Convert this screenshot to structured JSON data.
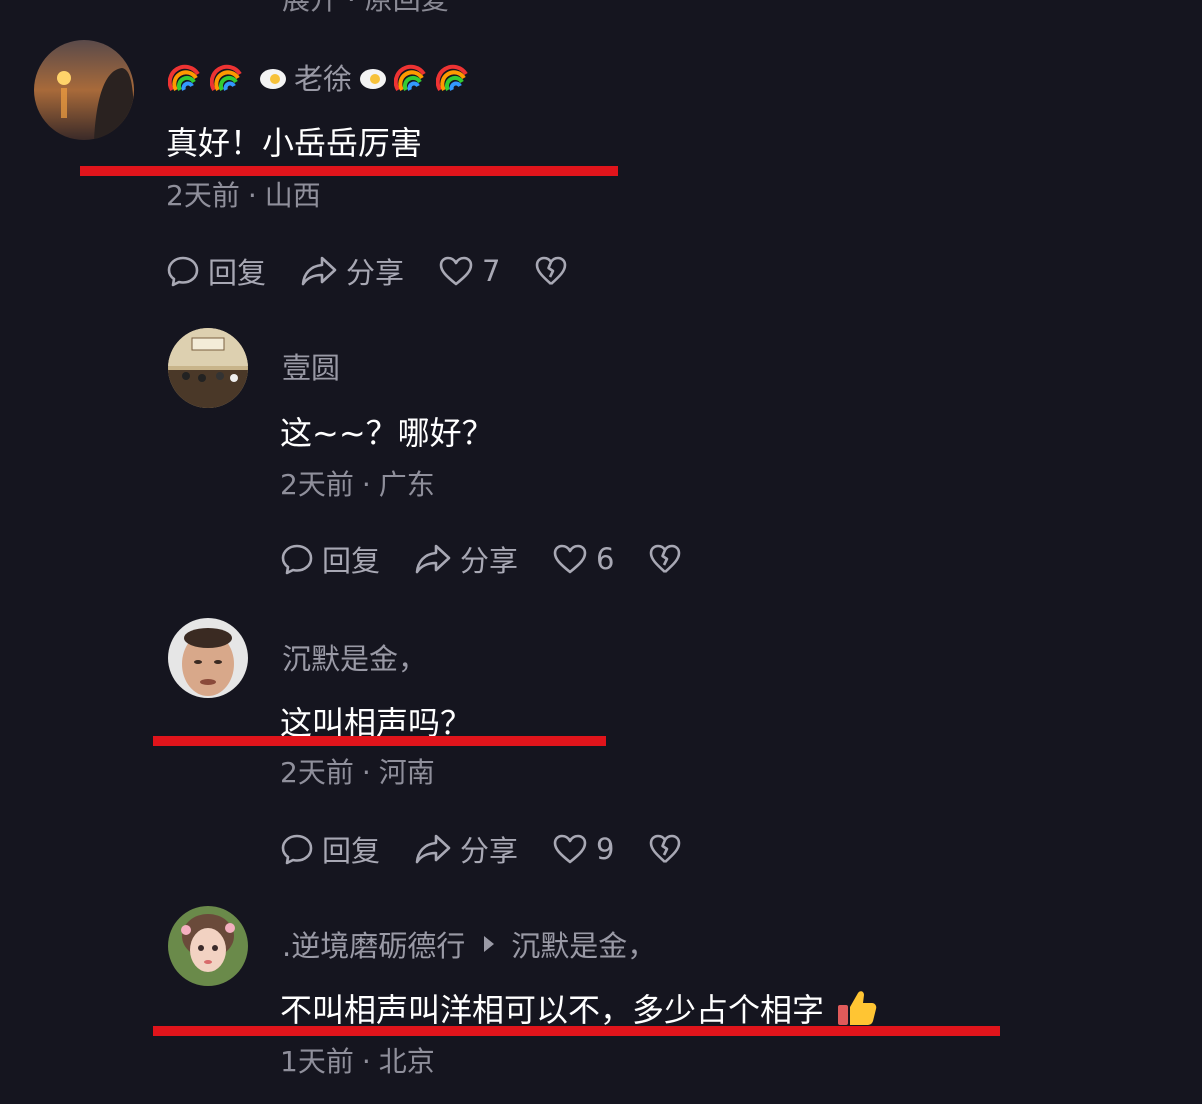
{
  "top_cut_text": "展开 · 原回复",
  "comments": [
    {
      "username": "老徐",
      "content": "真好！小岳岳厉害",
      "time": "2天前",
      "location": "山西",
      "reply_label": "回复",
      "share_label": "分享",
      "likes": "7"
    },
    {
      "username": "壹圆",
      "content": "这~~？哪好？",
      "time": "2天前",
      "location": "广东",
      "reply_label": "回复",
      "share_label": "分享",
      "likes": "6"
    },
    {
      "username": "沉默是金，",
      "content": "这叫相声吗？",
      "time": "2天前",
      "location": "河南",
      "reply_label": "回复",
      "share_label": "分享",
      "likes": "9"
    },
    {
      "username": ".逆境磨砺德行",
      "reply_to": "沉默是金，",
      "content": "不叫相声叫洋相可以不，多少占个相字",
      "time": "1天前",
      "location": "北京"
    }
  ],
  "separator": "·",
  "colors": {
    "background": "#15151f",
    "underline": "#e0141b",
    "text_primary": "#ffffff",
    "text_secondary": "#9a9aa6"
  }
}
